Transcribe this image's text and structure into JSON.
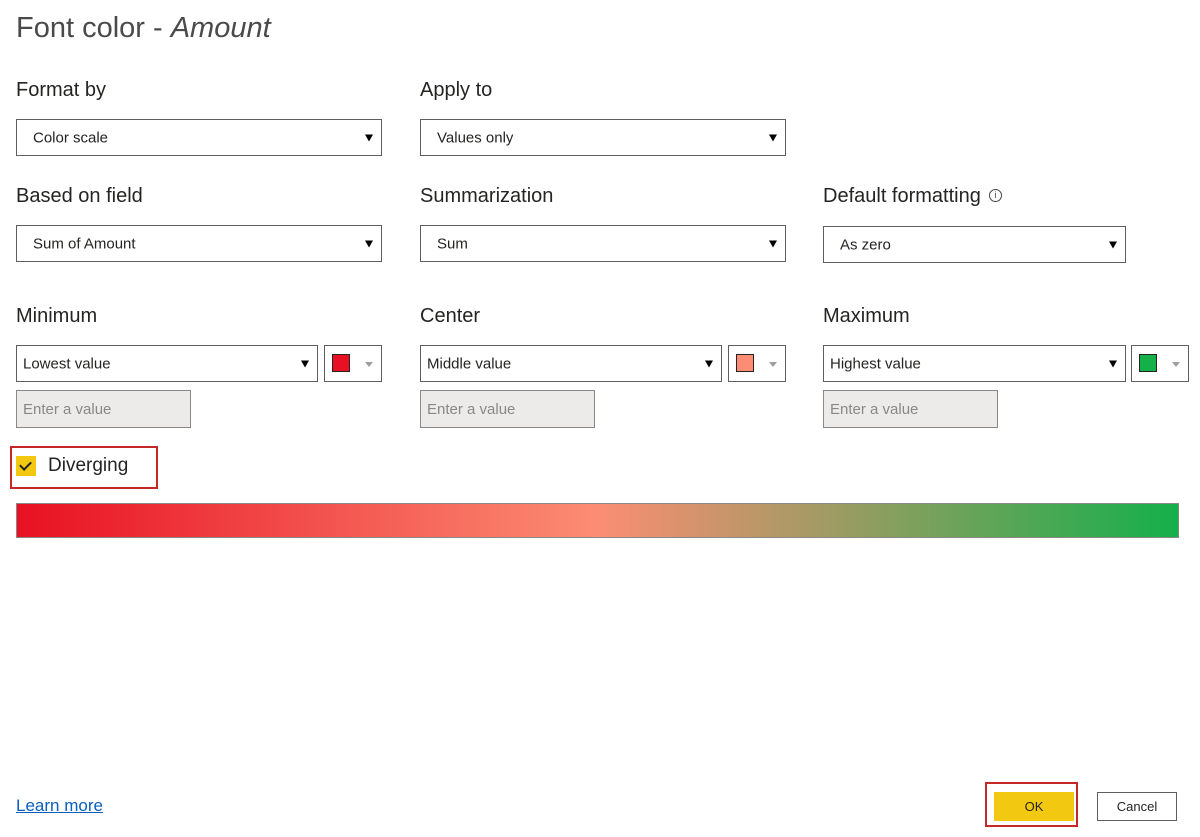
{
  "dialog": {
    "title_prefix": "Font color - ",
    "title_field": "Amount"
  },
  "format_by": {
    "label": "Format by",
    "value": "Color scale"
  },
  "apply_to": {
    "label": "Apply to",
    "value": "Values only"
  },
  "based_on_field": {
    "label": "Based on field",
    "value": "Sum of Amount"
  },
  "summarization": {
    "label": "Summarization",
    "value": "Sum"
  },
  "default_formatting": {
    "label": "Default formatting",
    "info_icon": "info-circle-icon",
    "value": "As zero"
  },
  "minimum": {
    "label": "Minimum",
    "value": "Lowest value",
    "color": "#e81123",
    "placeholder": "Enter a value"
  },
  "center": {
    "label": "Center",
    "value": "Middle value",
    "color": "#fc8d74",
    "placeholder": "Enter a value"
  },
  "maximum": {
    "label": "Maximum",
    "value": "Highest value",
    "color": "#14b04a",
    "placeholder": "Enter a value"
  },
  "diverging": {
    "label": "Diverging",
    "checked": true,
    "check_icon": "checkmark-icon"
  },
  "footer": {
    "learn_more": "Learn more",
    "ok_label": "OK",
    "cancel_label": "Cancel"
  },
  "colors": {
    "accent": "#f2c811",
    "highlight": "#c62828",
    "link": "#0a5ebd"
  }
}
